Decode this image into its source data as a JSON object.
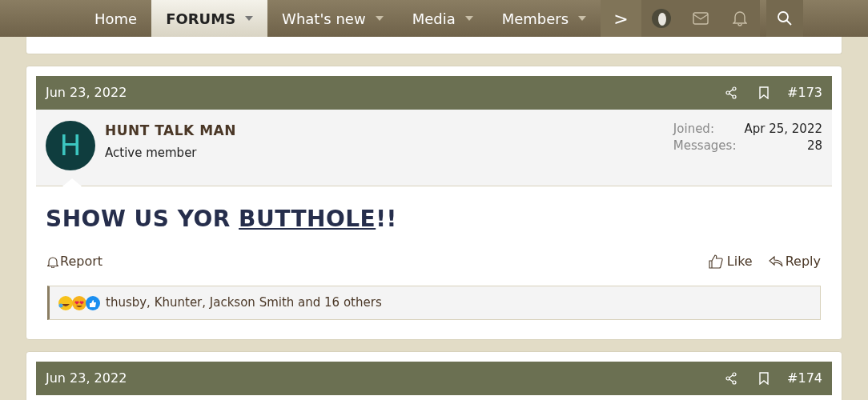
{
  "nav": {
    "items": [
      {
        "label": "Home",
        "selected": false,
        "dropdown": false
      },
      {
        "label": "FORUMS",
        "selected": true,
        "dropdown": true
      },
      {
        "label": "What's new",
        "selected": false,
        "dropdown": true
      },
      {
        "label": "Media",
        "selected": false,
        "dropdown": true
      },
      {
        "label": "Members",
        "selected": false,
        "dropdown": true
      }
    ],
    "more": ">"
  },
  "posts": [
    {
      "date": "Jun 23, 2022",
      "number": "#173",
      "author": {
        "initial": "H",
        "name": "HUNT TALK MAN",
        "title": "Active member",
        "joined_label": "Joined:",
        "joined": "Apr 25, 2022",
        "messages_label": "Messages:",
        "messages": "28"
      },
      "message": {
        "before": "SHOW US YOR ",
        "link": "BUTTHOLE",
        "after": "!!"
      },
      "actions": {
        "report": "Report",
        "like": "Like",
        "reply": "Reply"
      },
      "reactions": "thusby, Khunter, Jackson Smith and 16 others"
    },
    {
      "date": "Jun 23, 2022",
      "number": "#174"
    }
  ]
}
